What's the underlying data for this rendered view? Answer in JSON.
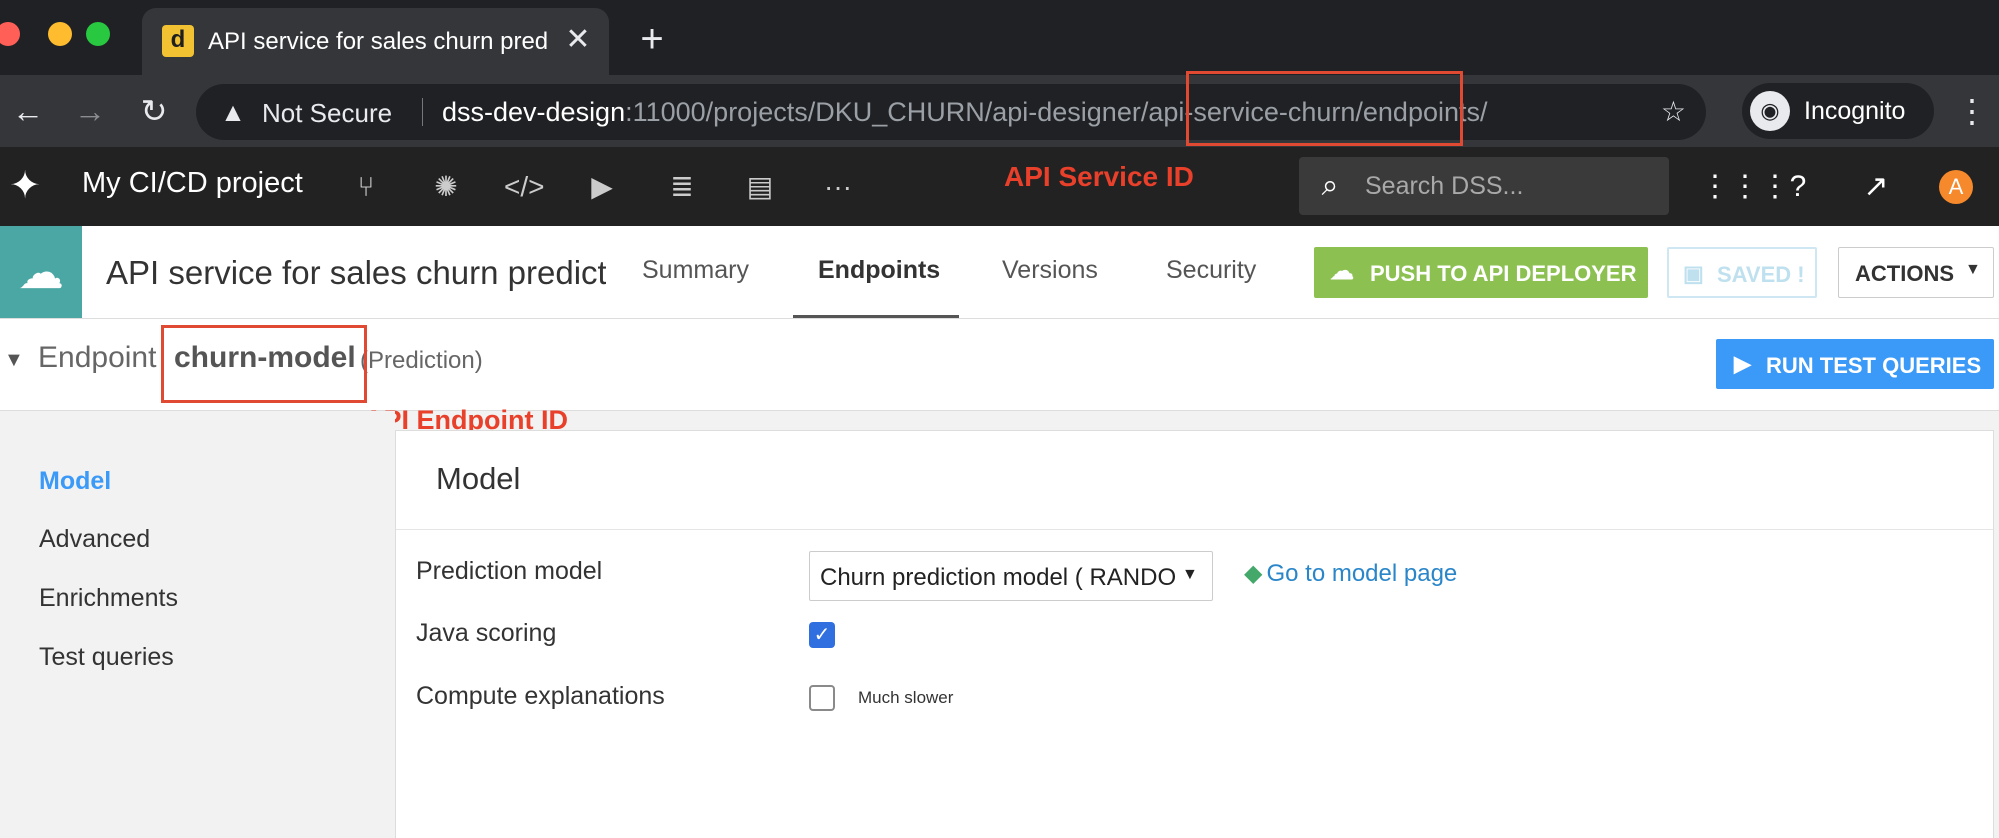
{
  "browser": {
    "tab": {
      "favicon_letter": "d",
      "title": "API service for sales churn prediction",
      "close_glyph": "✕"
    },
    "new_tab_glyph": "+",
    "security_label": "Not Secure",
    "url": {
      "host": "dss-dev-design",
      "rest": ":11000/projects/DKU_CHURN/api-designer/api-service-churn/endpoints/"
    },
    "incognito_label": "Incognito"
  },
  "dss": {
    "project_name": "My CI/CD project",
    "search_placeholder": "Search DSS...",
    "avatar_letter": "A"
  },
  "service": {
    "title": "API service for sales churn prediction",
    "tabs": [
      {
        "label": "Summary"
      },
      {
        "label": "Endpoints"
      },
      {
        "label": "Versions"
      },
      {
        "label": "Security"
      }
    ],
    "push_label": "PUSH TO API DEPLOYER",
    "saved_label": "SAVED !",
    "actions_label": "ACTIONS"
  },
  "endpoint": {
    "label": "Endpoint",
    "name": "churn-model",
    "type": "(Prediction)",
    "run_label": "RUN TEST QUERIES"
  },
  "annotations": {
    "service_id": "API Service ID",
    "endpoint_id": "API Endpoint ID",
    "color": "#e8402a"
  },
  "left_menu": [
    {
      "label": "Model"
    },
    {
      "label": "Advanced"
    },
    {
      "label": "Enrichments"
    },
    {
      "label": "Test queries"
    }
  ],
  "model_panel": {
    "title": "Model",
    "prediction_model_label": "Prediction model",
    "prediction_model_value": "Churn prediction model ( RANDOM_FOREST )",
    "go_to_model_label": "Go to model page",
    "java_scoring_label": "Java scoring",
    "java_scoring_checked": true,
    "compute_explanations_label": "Compute explanations",
    "compute_explanations_checked": false,
    "compute_explanations_hint": "Much slower"
  },
  "colors": {
    "push_green": "#8cc152",
    "run_blue": "#3b99f7",
    "active_blue": "#3b99f7",
    "link_blue": "#2a86c9",
    "service_teal": "#4aa7a3"
  }
}
